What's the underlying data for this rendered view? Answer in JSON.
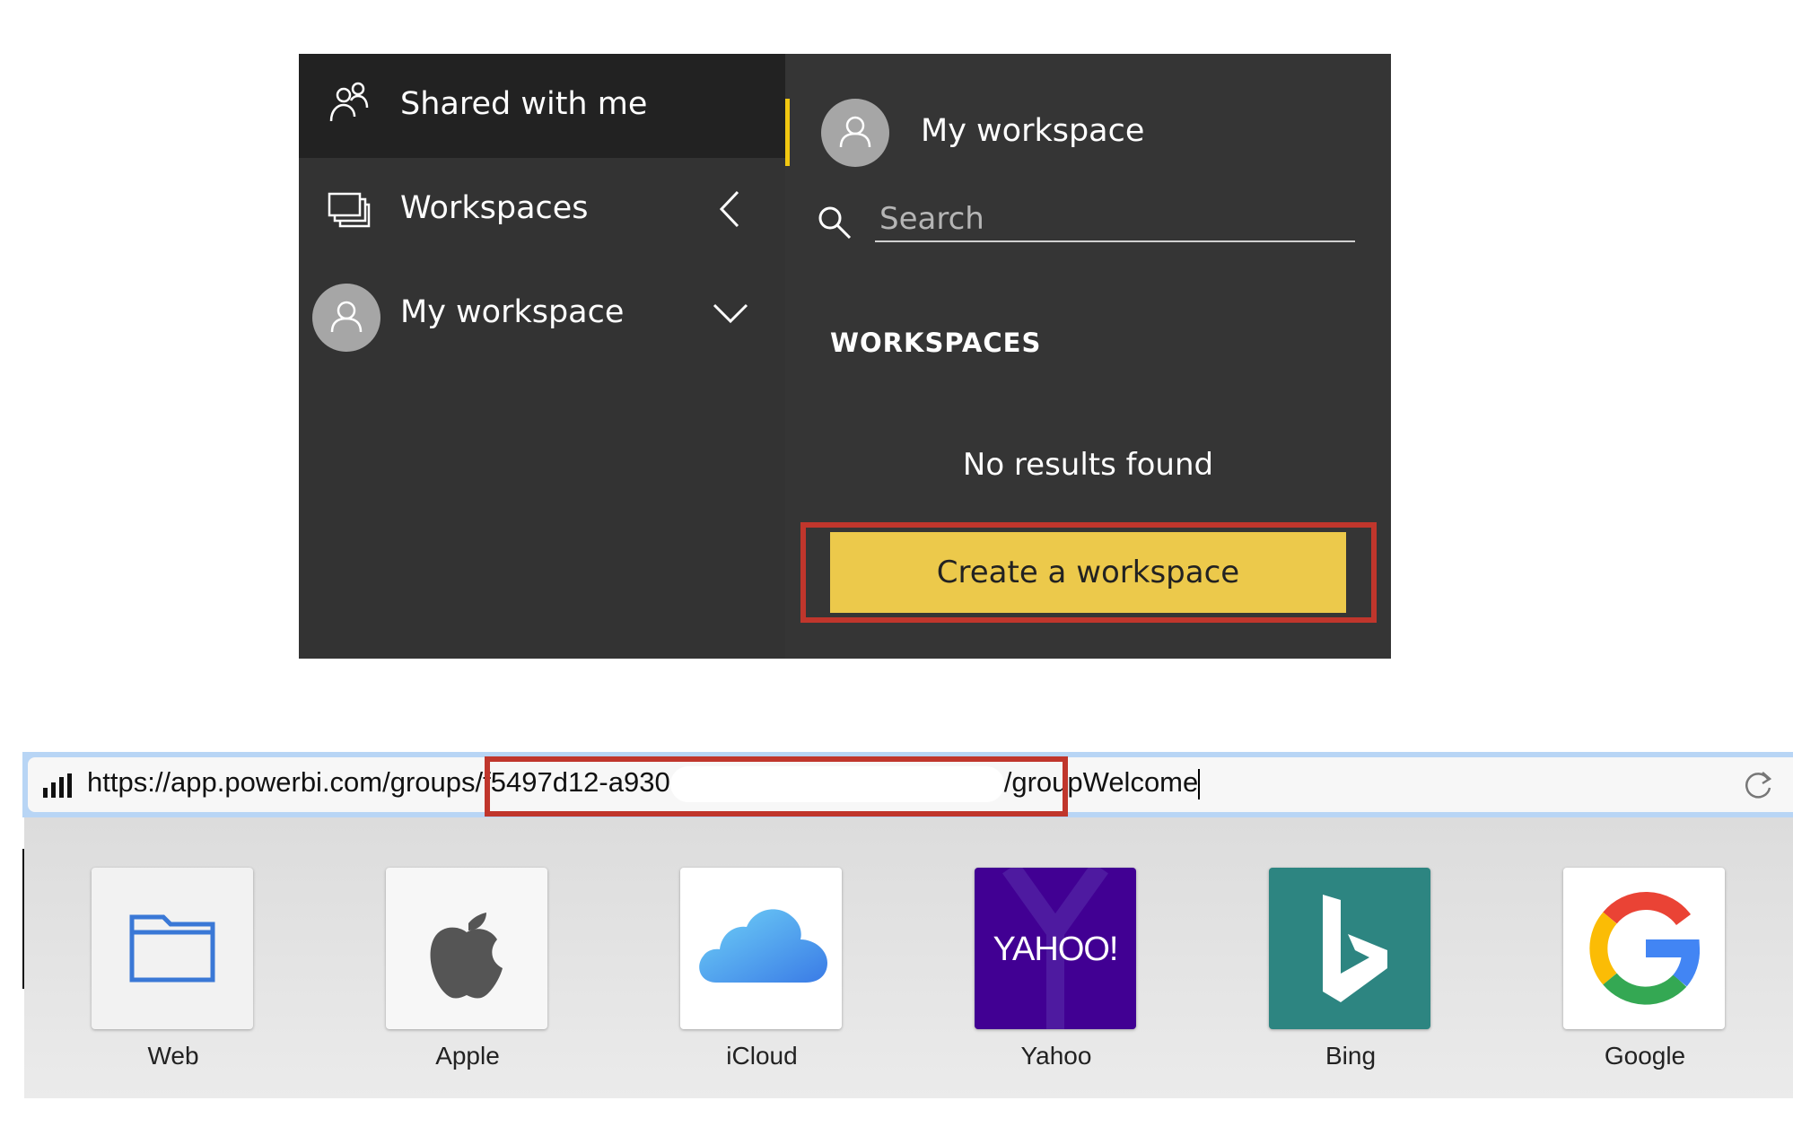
{
  "nav": {
    "items": [
      {
        "label": "Shared with me",
        "icon": "shared-people-icon"
      },
      {
        "label": "Workspaces",
        "icon": "workspaces-icon"
      },
      {
        "label": "My workspace",
        "icon": "avatar-icon"
      }
    ]
  },
  "flyout": {
    "title": "My workspace",
    "search_placeholder": "Search",
    "section_heading": "WORKSPACES",
    "empty_message": "No results found",
    "create_button": "Create a workspace",
    "accent_color": "#f2c811"
  },
  "browser": {
    "url_start": "https://app.powerbi.com/groups/f5497d12-a930",
    "url_end": "/groupWelcome",
    "favorites": [
      {
        "label": "Web",
        "icon": "folder-icon"
      },
      {
        "label": "Apple",
        "icon": "apple-icon"
      },
      {
        "label": "iCloud",
        "icon": "cloud-icon"
      },
      {
        "label": "Yahoo",
        "icon": "yahoo-icon",
        "logo_text": "YAHOO!"
      },
      {
        "label": "Bing",
        "icon": "bing-icon"
      },
      {
        "label": "Google",
        "icon": "google-icon"
      }
    ]
  },
  "colors": {
    "highlight": "#c0362c",
    "button": "#ecc94b",
    "yahoo": "#410093",
    "bing": "#2d8581"
  }
}
